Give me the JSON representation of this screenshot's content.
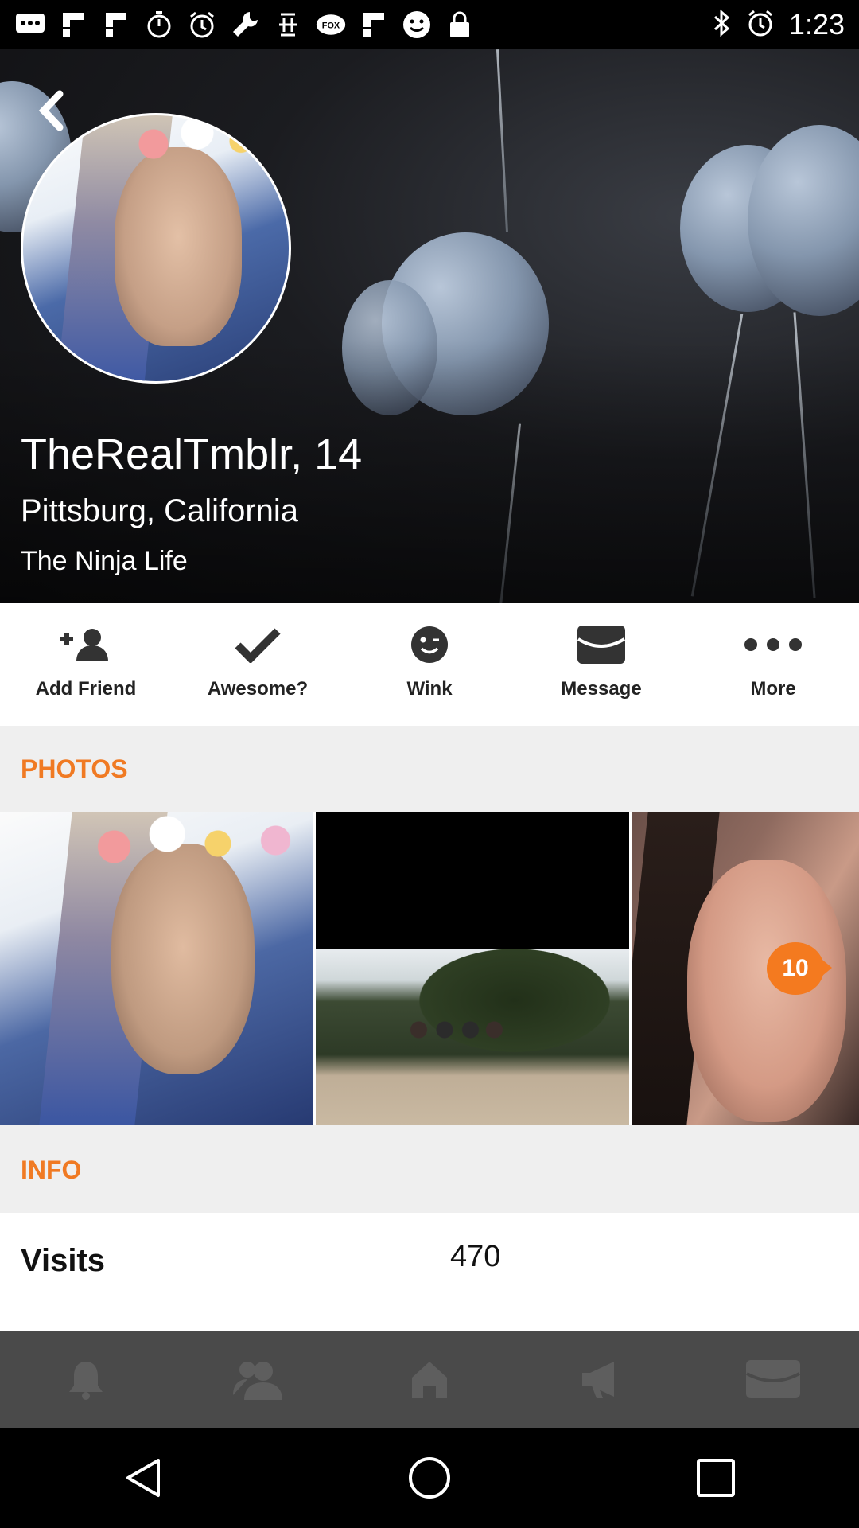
{
  "status_bar": {
    "time": "1:23",
    "left_icons": [
      "messaging-icon",
      "flipboard-icon",
      "flipboard-icon",
      "stopwatch-icon",
      "alarm-icon",
      "wrench-icon",
      "unknown-app-icon",
      "fox-sports-icon",
      "flipboard-icon",
      "smiley-icon",
      "lock-icon"
    ],
    "right_icons": [
      "bluetooth-icon",
      "alarm-icon"
    ]
  },
  "profile": {
    "name_age": "TheRealTmblr, 14",
    "location": "Pittsburg, California",
    "tagline": "The Ninja Life"
  },
  "actions": [
    {
      "label": "Add Friend",
      "icon": "add-friend-icon"
    },
    {
      "label": "Awesome?",
      "icon": "checkmark-icon"
    },
    {
      "label": "Wink",
      "icon": "wink-icon"
    },
    {
      "label": "Message",
      "icon": "message-icon"
    },
    {
      "label": "More",
      "icon": "more-icon"
    }
  ],
  "sections": {
    "photos_title": "PHOTOS",
    "info_title": "INFO"
  },
  "photos": {
    "count_badge": "10"
  },
  "info": {
    "visits_label": "Visits",
    "visits_value": "470"
  },
  "tabbar": [
    "notifications-icon",
    "friends-icon",
    "home-icon",
    "announcements-icon",
    "inbox-icon"
  ],
  "navbar": [
    "back-icon",
    "home-icon",
    "recents-icon"
  ],
  "colors": {
    "accent": "#f07a23",
    "tabbar_bg": "#4a4a4a",
    "section_bg": "#efefef"
  }
}
